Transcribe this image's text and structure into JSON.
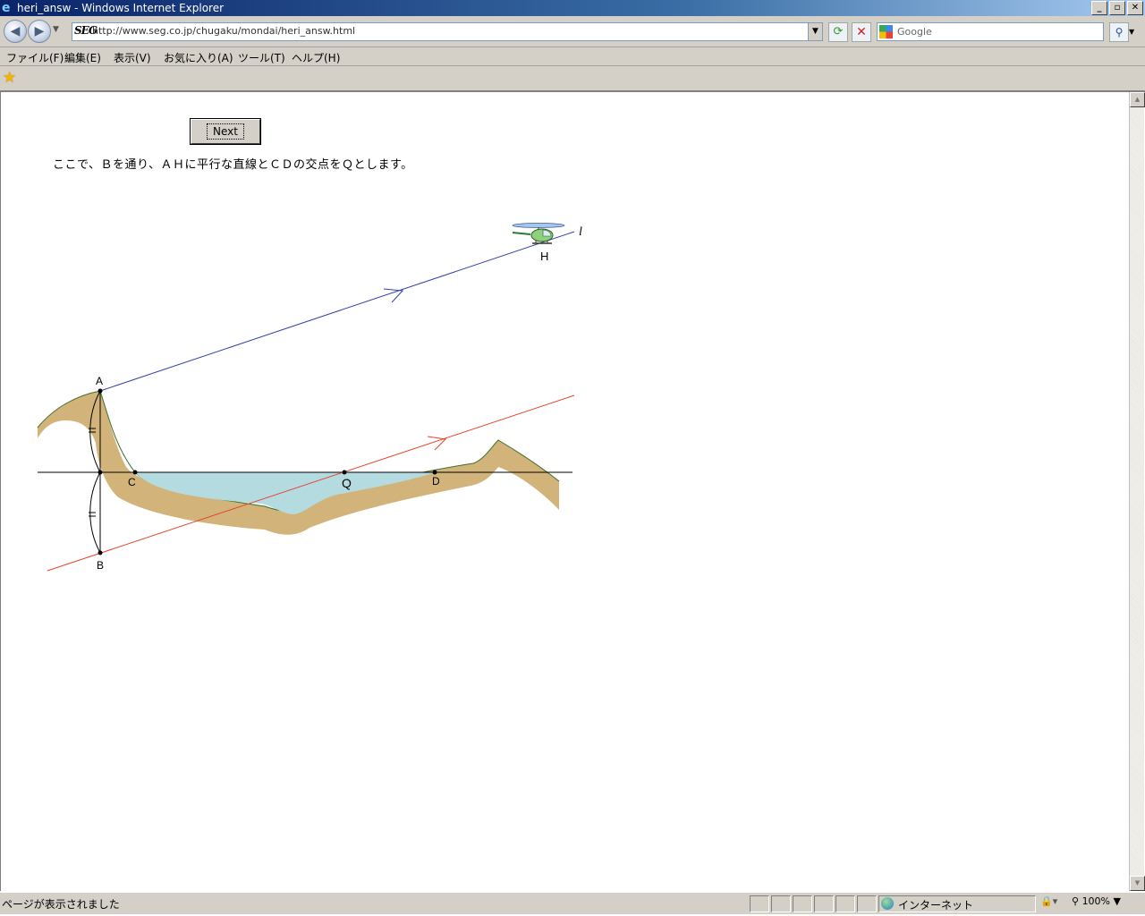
{
  "window": {
    "title": "heri_answ - Windows Internet Explorer",
    "icon": "ie-icon",
    "controls": [
      "minimize",
      "restore",
      "close"
    ]
  },
  "toolbar": {
    "address_logo": "SEG",
    "url": "http://www.seg.co.jp/chugaku/mondai/heri_answ.html",
    "search_placeholder": "Google"
  },
  "menu": {
    "items": [
      "ファイル(F)",
      "編集(E)",
      "表示(V)",
      "お気に入り(A)",
      "ツール(T)",
      "ヘルプ(H)"
    ]
  },
  "page": {
    "next_label": "Next",
    "explanation": "ここで、Ｂを通り、ＡＨに平行な直線とＣＤの交点をＱとします。",
    "diagram_labels": {
      "A": "A",
      "B": "B",
      "C": "C",
      "D": "D",
      "Q": "Q",
      "H": "H",
      "l": "l"
    },
    "colors": {
      "blue_line": "#2e3fa8",
      "red_line": "#e8402a",
      "ground": "#d2b47a",
      "ground_edge": "#3c6e2a",
      "water": "#b4dce0",
      "helicopter": "#8fd07a"
    }
  },
  "status": {
    "text": "ページが表示されました",
    "zone": "インターネット",
    "zoom": "100%"
  }
}
